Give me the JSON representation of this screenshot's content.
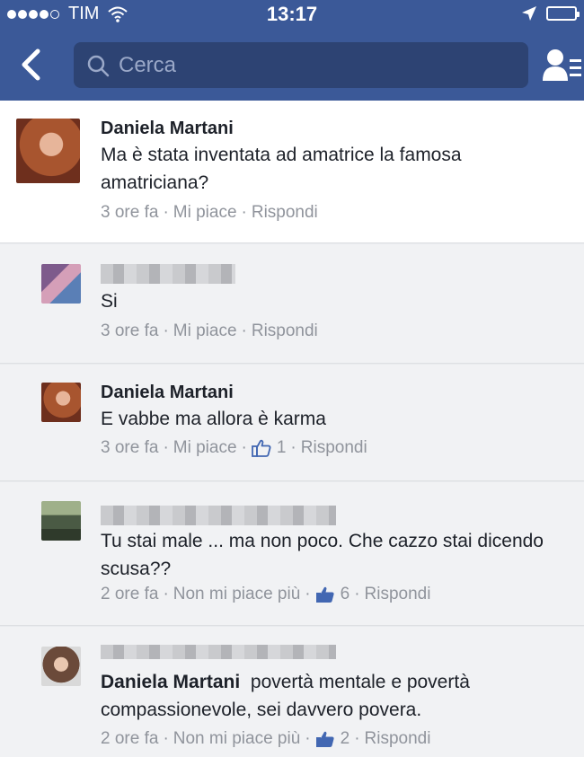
{
  "status_bar": {
    "carrier": "TIM",
    "time": "13:17"
  },
  "nav": {
    "search_placeholder": "Cerca"
  },
  "comment": {
    "author": "Daniela Martani",
    "text": "Ma è stata inventata ad amatrice la famosa amatriciana?",
    "time": "3 ore fa",
    "like": "Mi piace",
    "reply": "Rispondi"
  },
  "replies": [
    {
      "author": "",
      "text": "Si",
      "time": "3 ore fa",
      "like": "Mi piace",
      "likes": "",
      "reply": "Rispondi"
    },
    {
      "author": "Daniela Martani",
      "text": "E vabbe ma allora è karma",
      "time": "3 ore fa",
      "like": "Mi piace",
      "likes": "1",
      "reply": "Rispondi"
    },
    {
      "author": "",
      "text": "Tu stai male ... ma non poco. Che cazzo stai dicendo scusa??",
      "time": "2 ore fa",
      "like": "Non mi piace più",
      "likes": "6",
      "reply": "Rispondi"
    },
    {
      "author": "",
      "mention": "Daniela Martani",
      "text": "povertà mentale e povertà compassionevole, sei davvero povera.",
      "time": "2 ore fa",
      "like": "Non mi piace più",
      "likes": "2",
      "reply": "Rispondi"
    }
  ],
  "colors": {
    "header": "#3b5998",
    "like_icon": "#4267b2",
    "meta": "#90949c"
  }
}
